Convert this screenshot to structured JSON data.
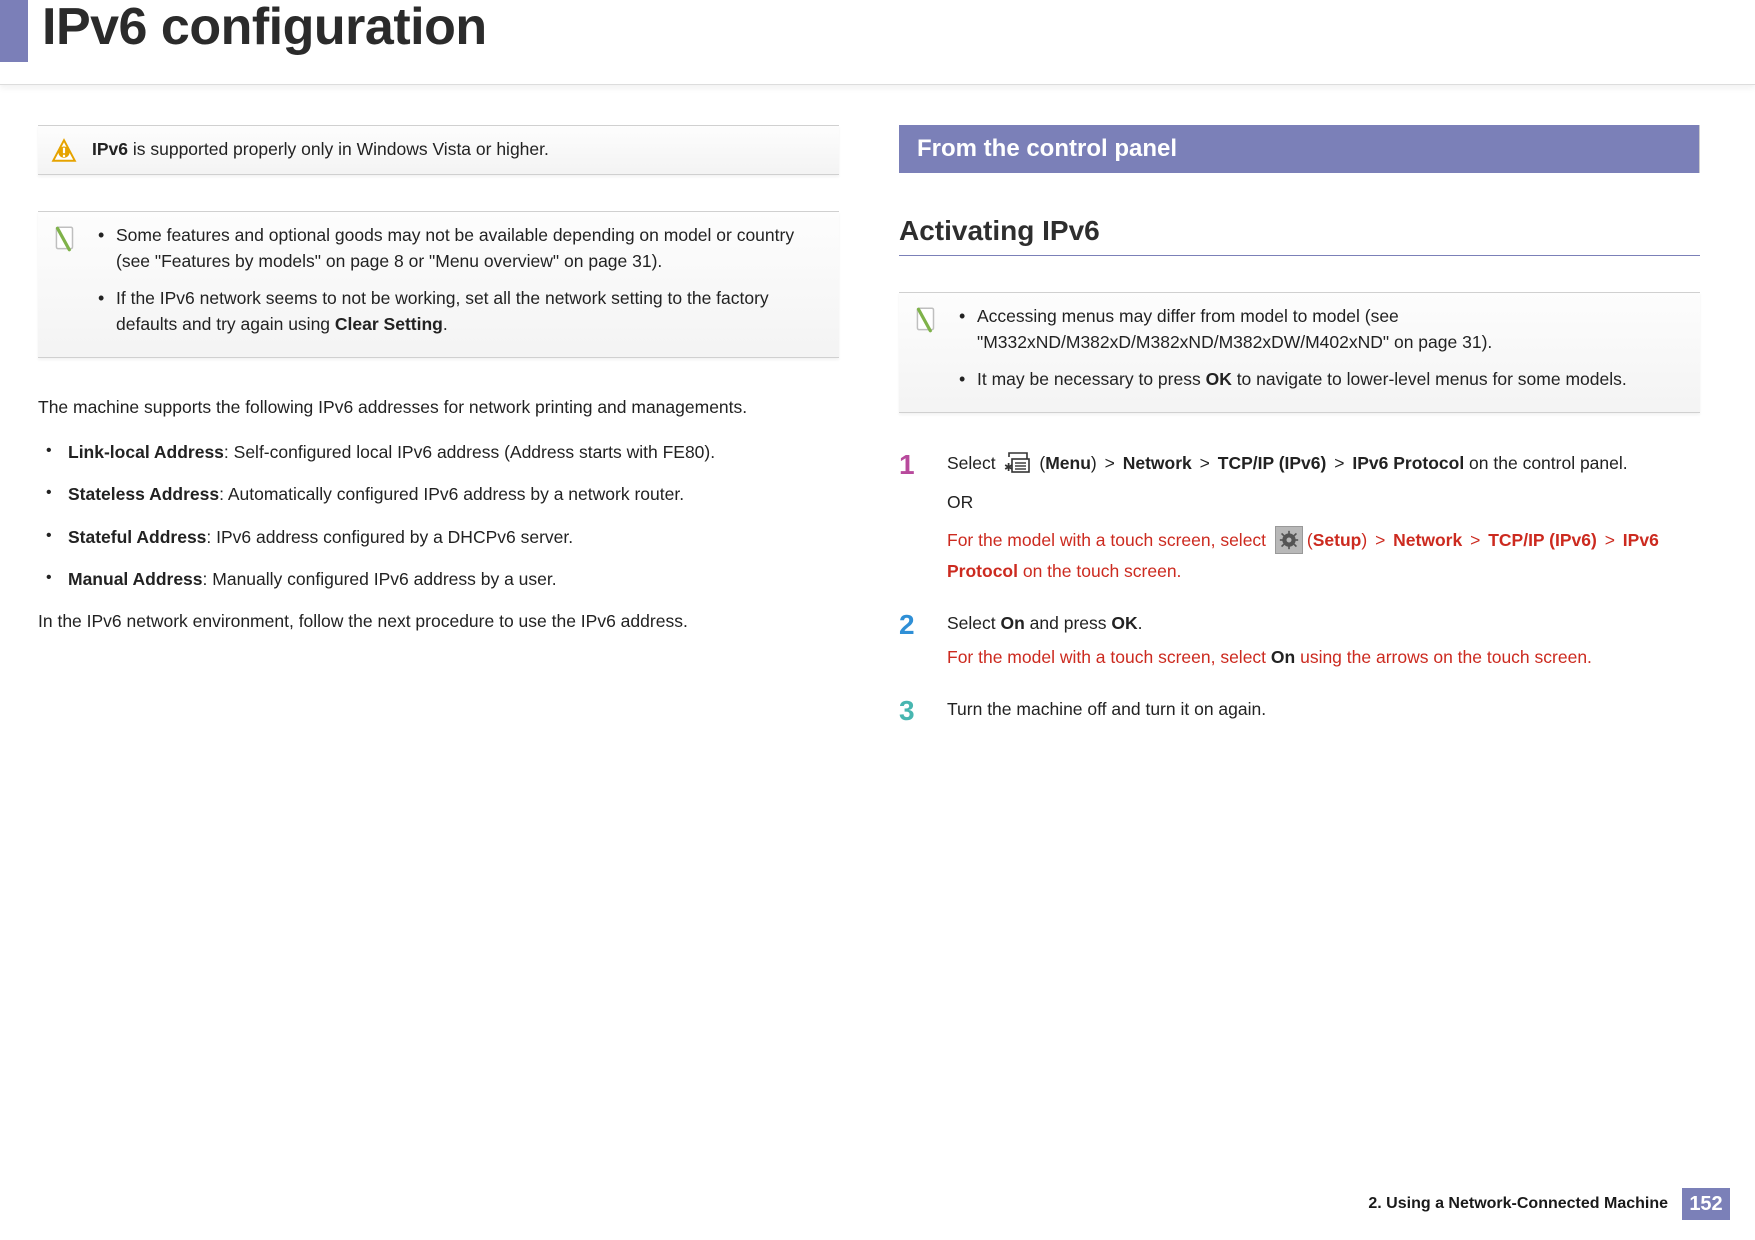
{
  "header": {
    "title": "IPv6 configuration"
  },
  "left": {
    "alert": {
      "strong": "IPv6",
      "rest": " is supported properly only in Windows Vista or higher."
    },
    "note": {
      "item1a": "Some features and optional goods may not be available depending on model or country (see \"Features by models\" on page 8",
      "item1_or": " or ",
      "item1b": "\"Menu overview\" on page 31).",
      "item2a": "If the IPv6 network seems to not be working, set all the network setting to the factory defaults and try again using ",
      "item2b": "Clear Setting",
      "item2c": "."
    },
    "intro": "The machine supports the following IPv6 addresses for network printing and managements.",
    "addr": {
      "linklocal": {
        "label": "Link-local Address",
        "desc": ": Self-configured local IPv6 address (Address starts with FE80)."
      },
      "stateless": {
        "label": "Stateless Address",
        "desc": ": Automatically configured IPv6 address by a network router."
      },
      "stateful": {
        "label": "Stateful Address",
        "desc": ": IPv6 address configured by a DHCPv6 server."
      },
      "manual": {
        "label": "Manual Address",
        "desc": ": Manually configured IPv6 address by a user."
      }
    },
    "outro": "In the IPv6 network environment, follow the next procedure to use the IPv6 address."
  },
  "right": {
    "section": "From the control panel",
    "subsection": "Activating IPv6",
    "note": {
      "item1": "Accessing menus may differ from model to model (see \"M332xND/M382xD/M382xND/M382xDW/M402xND\" on page 31).",
      "item2a": "It may be necessary to press ",
      "item2b": "OK",
      "item2c": " to navigate to lower-level menus for some models."
    },
    "steps": {
      "s1": {
        "num": "1",
        "pre": "Select ",
        "menu": "Menu",
        "path": {
          "network": "Network",
          "tcpip": "TCP/IP (IPv6)",
          "proto": "IPv6 Protocol"
        },
        "post": " on the control panel.",
        "or": "OR",
        "touch_pre": "For the model with a touch screen, select ",
        "setup": "Setup",
        "touch_post": " on the touch screen."
      },
      "s2": {
        "num": "2",
        "a": "Select ",
        "on": "On",
        "b": " and press ",
        "ok": "OK",
        "c": ".",
        "touch_a": "For the model with a touch screen, select ",
        "touch_on": "On",
        "touch_b": " using the arrows on the touch screen."
      },
      "s3": {
        "num": "3",
        "text": "Turn the machine off and turn it on again."
      }
    }
  },
  "footer": {
    "chapter": "2.  Using a Network-Connected Machine",
    "page": "152"
  }
}
